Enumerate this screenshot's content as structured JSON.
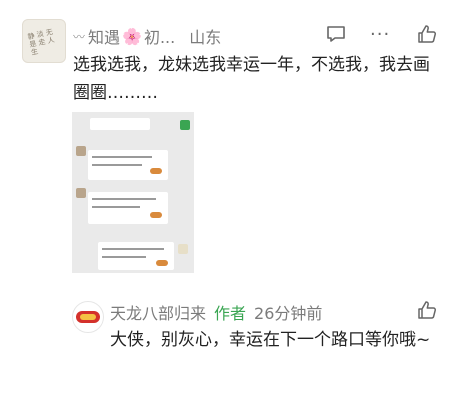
{
  "comment": {
    "user_prefix": "〰",
    "user_name_part1": "知遇",
    "user_flower": "🌸",
    "user_name_part2": "初...",
    "location": "山东",
    "more_glyph": "···",
    "text": "选我选我，龙妹选我幸运一年，不选我，我去画圈圈………",
    "avatar_scribble": "静 淡 无 是 走 人 生"
  },
  "reply": {
    "user_name": "天龙八部归来",
    "author_badge": "作者",
    "time": "26分钟前",
    "text": "大侠，别灰心，幸运在下一个路口等你哦~"
  },
  "colors": {
    "author_green": "#3aa552",
    "meta_gray": "#7b7b7b",
    "text": "#222222"
  }
}
